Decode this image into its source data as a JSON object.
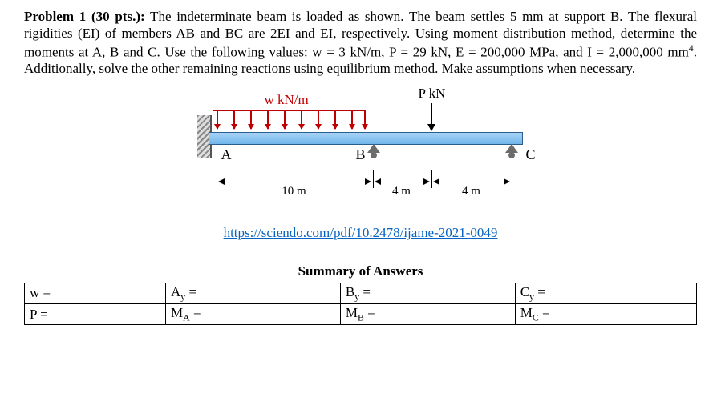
{
  "problem": {
    "heading": "Problem 1 (30 pts.):",
    "body_1": " The indeterminate beam is loaded as shown. The beam settles 5 mm at support B. The flexural rigidities (EI) of members AB and BC are 2EI and EI, respectively. Using moment distribution method, determine the moments at A, B and C. Use the following values: w = 3 kN/m, P = 29 kN, E = 200,000 MPa, and I = 2,000,000 mm",
    "body_2": ". Additionally, solve the other remaining reactions using equilibrium method. Make assumptions when necessary."
  },
  "figure": {
    "p_label": "P  kN",
    "w_label": "w kN/m",
    "node_a": "A",
    "node_b": "B",
    "node_c": "C",
    "dim_ab": "10 m",
    "dim_bp": "4 m",
    "dim_pc": "4 m"
  },
  "link": {
    "text": "https://sciendo.com/pdf/10.2478/ijame-2021-0049"
  },
  "summary": {
    "title": "Summary of Answers",
    "rows": [
      {
        "c1": "w =",
        "c2_pre": "A",
        "c2_sub": "y",
        "c2_post": " =",
        "c3_pre": "B",
        "c3_sub": "y",
        "c3_post": " =",
        "c4_pre": "C",
        "c4_sub": "y",
        "c4_post": " ="
      },
      {
        "c1": "P =",
        "c2_pre": "M",
        "c2_sub": "A",
        "c2_post": " =",
        "c3_pre": "M",
        "c3_sub": "B",
        "c3_post": " =",
        "c4_pre": "M",
        "c4_sub": "C",
        "c4_post": " ="
      }
    ]
  }
}
